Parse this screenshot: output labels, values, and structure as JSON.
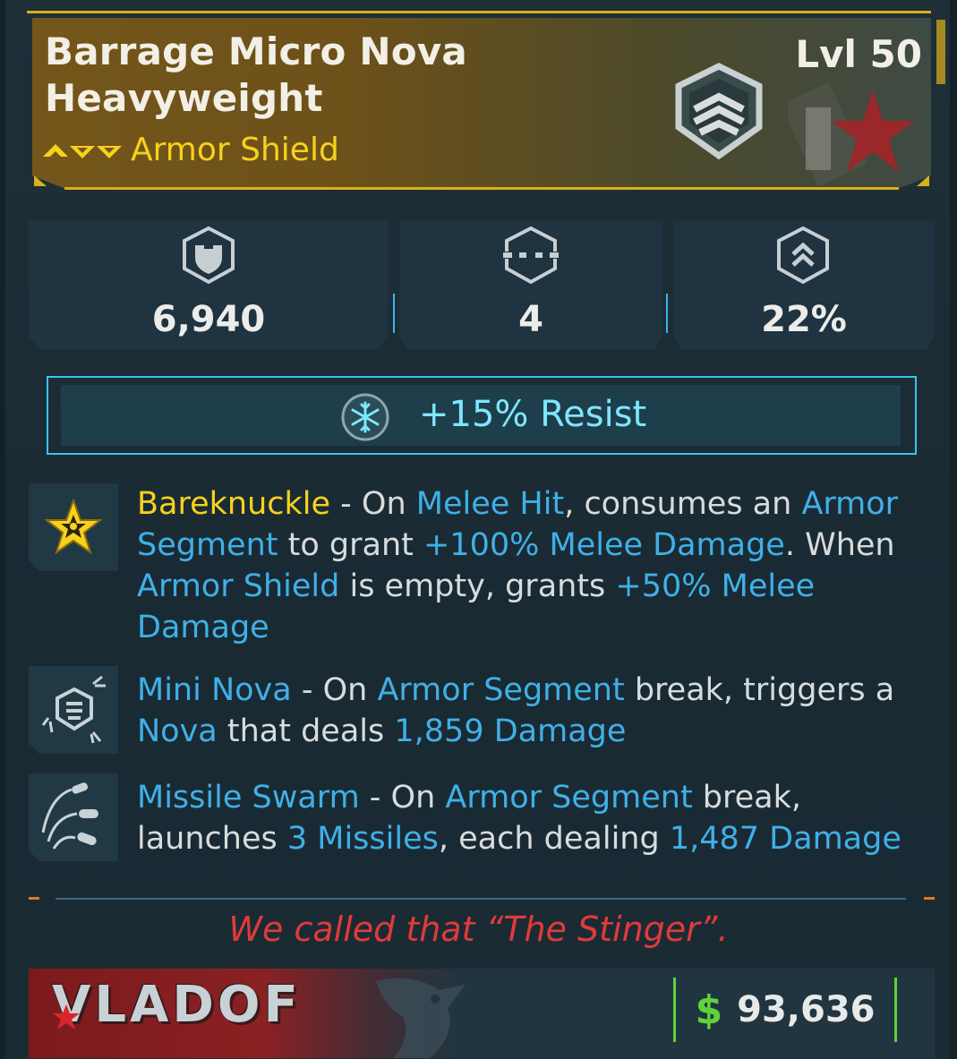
{
  "item": {
    "name_line1": "Barrage Micro Nova",
    "name_line2": "Heavyweight",
    "level": "Lvl 50",
    "type": "Armor Shield",
    "rarity_color": "#d8b11a"
  },
  "stats": [
    {
      "icon": "shield-capacity-icon",
      "value": "6,940"
    },
    {
      "icon": "armor-segments-icon",
      "value": "4"
    },
    {
      "icon": "recharge-icon",
      "value": "22%"
    }
  ],
  "resist": {
    "icon": "cryo-snowflake-icon",
    "label": "+15% Resist"
  },
  "perks": [
    {
      "icon": "bareknuckle-star-icon",
      "parts": [
        "Bareknuckle",
        " - On ",
        "Melee Hit",
        ", consumes an ",
        "Armor Segment",
        " to grant ",
        "+100% Melee Damage",
        ". When ",
        "Armor Shield",
        " is empty, grants ",
        "+50% Melee Damage"
      ]
    },
    {
      "icon": "mini-nova-icon",
      "parts": [
        "Mini Nova",
        " - On ",
        "Armor Segment",
        " break, triggers a ",
        "Nova",
        " that deals ",
        "1,859 Damage"
      ]
    },
    {
      "icon": "missile-swarm-icon",
      "parts": [
        "Missile Swarm",
        " - On ",
        "Armor Segment",
        " break, launches ",
        "3 Missiles",
        ", each dealing ",
        "1,487 Damage"
      ]
    }
  ],
  "flavor_text": "We called that “The Stinger”.",
  "manufacturer": "VLADOF",
  "price": {
    "symbol": "$",
    "value": "93,636"
  },
  "colors": {
    "gold": "#f7d21c",
    "blue_highlight": "#3fb0e8",
    "cryo": "#7de7ff",
    "flavor_red": "#e13a3a",
    "money_green": "#5ed23a"
  }
}
